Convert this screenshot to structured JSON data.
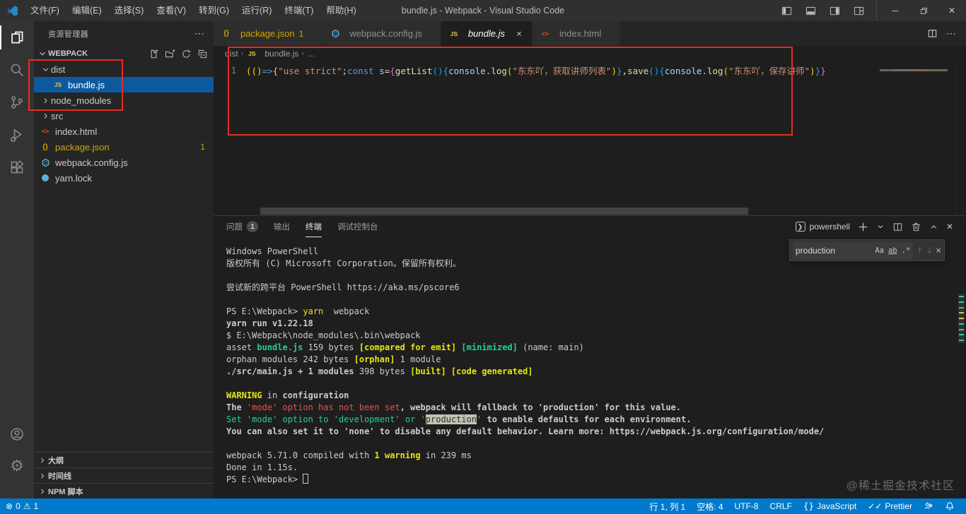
{
  "colors": {
    "statusbar": "#007acc",
    "annotation_red": "#e62d24",
    "selection_blue": "#0b5aa0",
    "terminal_yellow": "#e5e510",
    "terminal_green": "#23d18b",
    "terminal_red": "#f14c4c",
    "warning_file": "#cca700"
  },
  "titlebar": {
    "menus": [
      "文件(F)",
      "编辑(E)",
      "选择(S)",
      "查看(V)",
      "转到(G)",
      "运行(R)",
      "终端(T)",
      "帮助(H)"
    ],
    "title": "bundle.js - Webpack - Visual Studio Code"
  },
  "activitybar": {
    "items": [
      "explorer",
      "search",
      "source-control",
      "run-debug",
      "extensions"
    ],
    "bottom": [
      "account",
      "settings"
    ]
  },
  "sidebar": {
    "header": "资源管理器",
    "more": "⋯",
    "section": "WEBPACK",
    "tree": [
      {
        "label": "dist",
        "kind": "folder",
        "expanded": true,
        "indent": 1
      },
      {
        "label": "bundle.js",
        "kind": "file",
        "icon": "js",
        "indent": 2,
        "selected": true
      },
      {
        "label": "node_modules",
        "kind": "folder",
        "expanded": false,
        "indent": 1
      },
      {
        "label": "src",
        "kind": "folder",
        "expanded": false,
        "indent": 1
      },
      {
        "label": "index.html",
        "kind": "file",
        "icon": "html",
        "indent": 1
      },
      {
        "label": "package.json",
        "kind": "file",
        "icon": "json",
        "indent": 1,
        "badge": "1",
        "warn": true
      },
      {
        "label": "webpack.config.js",
        "kind": "file",
        "icon": "webpack",
        "indent": 1
      },
      {
        "label": "yarn.lock",
        "kind": "file",
        "icon": "yarn",
        "indent": 1
      }
    ],
    "sections": [
      "大纲",
      "时间线",
      "NPM 脚本"
    ]
  },
  "editor": {
    "tabs": [
      {
        "label": "package.json",
        "icon": "json",
        "badge": "1",
        "warn": true
      },
      {
        "label": "webpack.config.js",
        "icon": "webpack"
      },
      {
        "label": "bundle.js",
        "icon": "js",
        "active": true,
        "italic": true,
        "close": "×"
      },
      {
        "label": "index.html",
        "icon": "html"
      }
    ],
    "more": "⋯",
    "breadcrumb": [
      {
        "label": "dist"
      },
      {
        "label": "bundle.js",
        "icon": "js"
      },
      {
        "label": "…"
      }
    ],
    "line_number": "1",
    "code_segments": [
      {
        "t": "((",
        "c": "gold"
      },
      {
        "t": ")",
        "c": "gold"
      },
      {
        "t": "=>",
        "c": "blue"
      },
      {
        "t": "{",
        "c": "gold"
      },
      {
        "t": "\"use strict\"",
        "c": "str"
      },
      {
        "t": ";",
        "c": "fg"
      },
      {
        "t": "const",
        "c": "blue"
      },
      {
        "t": " s",
        "c": "var"
      },
      {
        "t": "=",
        "c": "fg"
      },
      {
        "t": "{",
        "c": "pink"
      },
      {
        "t": "getList",
        "c": "fn"
      },
      {
        "t": "()",
        "c": "blue2"
      },
      {
        "t": "{",
        "c": "blue2"
      },
      {
        "t": "console",
        "c": "var"
      },
      {
        "t": ".",
        "c": "fg"
      },
      {
        "t": "log",
        "c": "fn"
      },
      {
        "t": "(",
        "c": "gold"
      },
      {
        "t": "\"东东吖，获取讲师列表\"",
        "c": "str"
      },
      {
        "t": ")",
        "c": "gold"
      },
      {
        "t": "}",
        "c": "blue2"
      },
      {
        "t": ",",
        "c": "fg"
      },
      {
        "t": "save",
        "c": "fn"
      },
      {
        "t": "()",
        "c": "blue2"
      },
      {
        "t": "{",
        "c": "blue2"
      },
      {
        "t": "console",
        "c": "var"
      },
      {
        "t": ".",
        "c": "fg"
      },
      {
        "t": "log",
        "c": "fn"
      },
      {
        "t": "(",
        "c": "gold"
      },
      {
        "t": "\"东东吖，保存讲师\"",
        "c": "str"
      },
      {
        "t": ")",
        "c": "gold"
      },
      {
        "t": "}",
        "c": "blue2"
      },
      {
        "t": "}",
        "c": "pink"
      }
    ]
  },
  "panel": {
    "tabs": [
      {
        "label": "问题",
        "badge": "1"
      },
      {
        "label": "输出"
      },
      {
        "label": "终端",
        "active": true
      },
      {
        "label": "调试控制台"
      }
    ],
    "shell_label": "powershell",
    "search": {
      "value": "production",
      "match_case": "Aa",
      "whole_word": "ab",
      "regex": ".*",
      "prev": "↑",
      "next": "↓",
      "close": "×"
    },
    "terminal_lines": [
      [
        {
          "t": "Windows PowerShell"
        }
      ],
      [
        {
          "t": "版权所有 (C) Microsoft Corporation。保留所有权利。"
        }
      ],
      [],
      [
        {
          "t": "尝试新的跨平台 PowerShell https://aka.ms/pscore6"
        }
      ],
      [],
      [
        {
          "t": "PS E:\\Webpack> "
        },
        {
          "t": "yarn",
          "c": "yellow"
        },
        {
          "t": "  webpack"
        }
      ],
      [
        {
          "t": "yarn run v1.22.18",
          "b": true
        }
      ],
      [
        {
          "t": "$ E:\\Webpack\\node_modules\\.bin\\webpack"
        }
      ],
      [
        {
          "t": "asset "
        },
        {
          "t": "bundle.js",
          "c": "green",
          "b": true
        },
        {
          "t": " 159 bytes "
        },
        {
          "t": "[compared for emit]",
          "c": "yellow",
          "b": true
        },
        {
          "t": " "
        },
        {
          "t": "[minimized]",
          "c": "green",
          "b": true
        },
        {
          "t": " (name: main)"
        }
      ],
      [
        {
          "t": "orphan modules 242 bytes "
        },
        {
          "t": "[orphan]",
          "c": "yellow",
          "b": true
        },
        {
          "t": " 1 module"
        }
      ],
      [
        {
          "t": "./src/main.js + 1 modules",
          "b": true
        },
        {
          "t": " 398 bytes "
        },
        {
          "t": "[built]",
          "c": "yellow",
          "b": true
        },
        {
          "t": " "
        },
        {
          "t": "[code generated]",
          "c": "yellow",
          "b": true
        }
      ],
      [],
      [
        {
          "t": "WARNING",
          "c": "yellow",
          "b": true
        },
        {
          "t": " in "
        },
        {
          "t": "configuration",
          "b": true
        }
      ],
      [
        {
          "t": "The ",
          "b": true
        },
        {
          "t": "'mode' option has not been set",
          "c": "red"
        },
        {
          "t": ", webpack will fallback to 'production' for this value.",
          "b": true
        }
      ],
      [
        {
          "t": "Set 'mode' option to 'development' or '",
          "c": "green"
        },
        {
          "t": "production",
          "c": "green",
          "hl": true
        },
        {
          "t": "'",
          "c": "green"
        },
        {
          "t": " to enable defaults for each environment.",
          "b": true
        }
      ],
      [
        {
          "t": "You can also set it to 'none' to disable any default behavior. Learn more: https://webpack.js.org/configuration/mode/",
          "b": true
        }
      ],
      [],
      [
        {
          "t": "webpack 5.71.0 compiled with "
        },
        {
          "t": "1 warning",
          "c": "yellow",
          "b": true
        },
        {
          "t": " in 239 ms"
        }
      ],
      [
        {
          "t": "Done in 1.15s."
        }
      ],
      [
        {
          "t": "PS E:\\Webpack> "
        },
        {
          "t": "",
          "cursor": true
        }
      ]
    ],
    "watermark": "@稀土掘金技术社区"
  },
  "statusbar": {
    "errors": "0",
    "warnings": "1",
    "right": [
      {
        "name": "cursor-position",
        "label": "行 1, 列 1"
      },
      {
        "name": "indentation",
        "label": "空格: 4"
      },
      {
        "name": "encoding",
        "label": "UTF-8"
      },
      {
        "name": "eol",
        "label": "CRLF"
      },
      {
        "name": "language-mode",
        "label": "JavaScript",
        "glyph": "{}"
      },
      {
        "name": "formatter",
        "label": "Prettier",
        "glyph": "✓✓"
      },
      {
        "name": "feedback",
        "icon": "feedback"
      },
      {
        "name": "notifications",
        "icon": "bell"
      }
    ]
  }
}
